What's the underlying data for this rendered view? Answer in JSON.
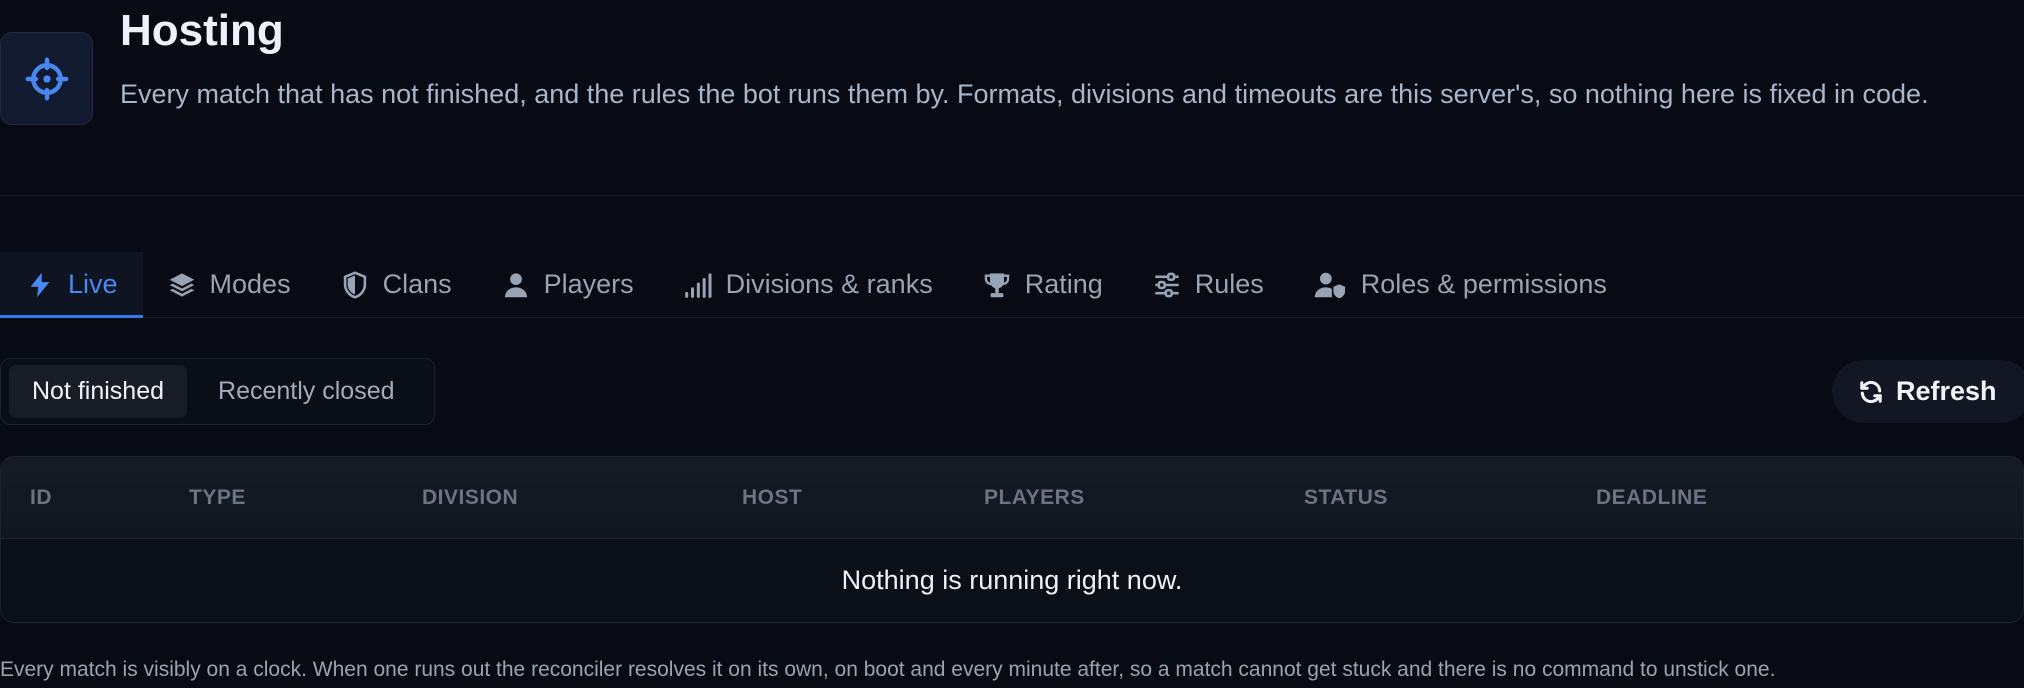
{
  "header": {
    "title": "Hosting",
    "subtitle": "Every match that has not finished, and the rules the bot runs them by. Formats, divisions and timeouts are this server's, so nothing here is fixed in code.",
    "icon": "crosshair-icon"
  },
  "tabs": [
    {
      "label": "Live",
      "icon": "bolt-icon",
      "active": true
    },
    {
      "label": "Modes",
      "icon": "layers-icon",
      "active": false
    },
    {
      "label": "Clans",
      "icon": "shield-icon",
      "active": false
    },
    {
      "label": "Players",
      "icon": "user-icon",
      "active": false
    },
    {
      "label": "Divisions & ranks",
      "icon": "signal-bars-icon",
      "active": false
    },
    {
      "label": "Rating",
      "icon": "trophy-icon",
      "active": false
    },
    {
      "label": "Rules",
      "icon": "sliders-icon",
      "active": false
    },
    {
      "label": "Roles & permissions",
      "icon": "user-shield-icon",
      "active": false
    }
  ],
  "filter": {
    "options": [
      "Not finished",
      "Recently closed"
    ],
    "selected": "Not finished"
  },
  "refresh_label": "Refresh",
  "table": {
    "columns": [
      "ID",
      "TYPE",
      "DIVISION",
      "HOST",
      "PLAYERS",
      "STATUS",
      "DEADLINE"
    ],
    "empty_message": "Nothing is running right now."
  },
  "footer_note": "Every match is visibly on a clock. When one runs out the reconciler resolves it on its own, on boot and every minute after, so a match cannot get stuck and there is no command to unstick one.",
  "colors": {
    "background": "#080b13",
    "accent": "#3b78e7",
    "muted_text": "#98a3b3"
  }
}
